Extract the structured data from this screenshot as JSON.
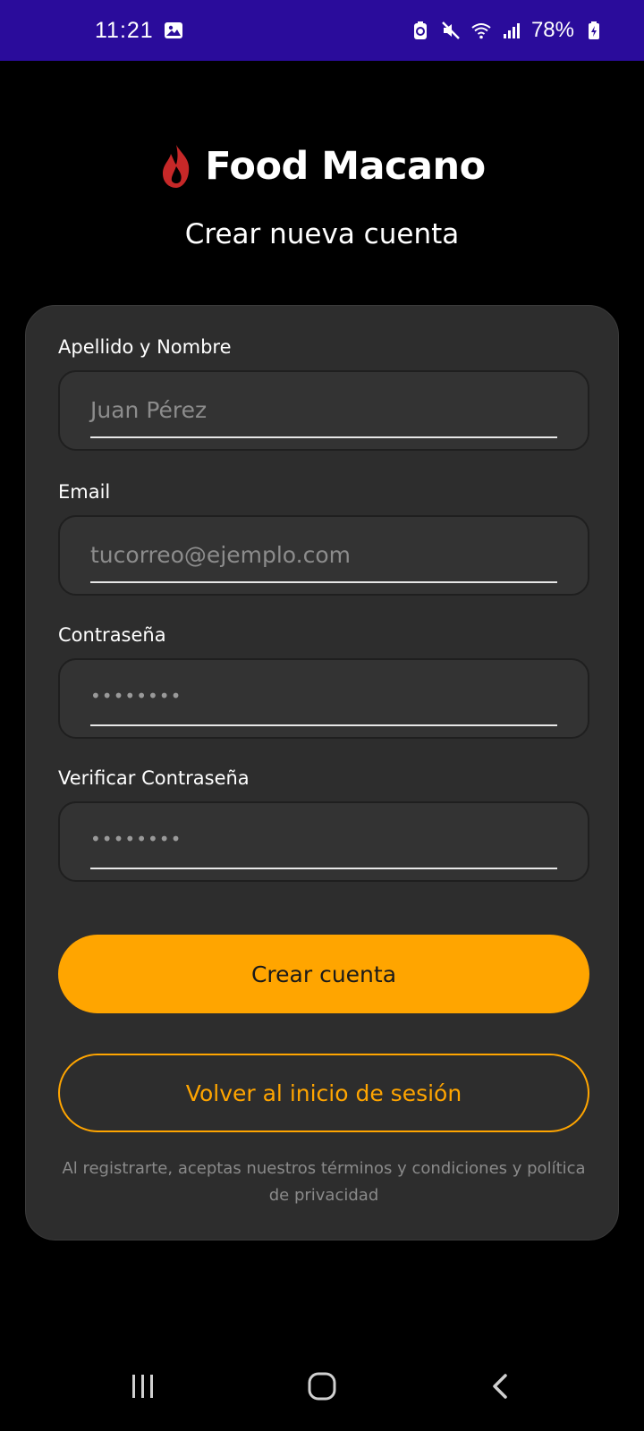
{
  "status_bar": {
    "time": "11:21",
    "battery": "78%",
    "icons": [
      "gallery-icon",
      "battery-saver-icon",
      "mute-icon",
      "wifi-icon",
      "signal-icon",
      "battery-icon"
    ]
  },
  "brand": {
    "name": "Food Macano",
    "logo_icon": "flame-icon",
    "logo_color": "#c62828"
  },
  "page": {
    "title": "Crear nueva cuenta"
  },
  "form": {
    "fields": [
      {
        "label": "Apellido y Nombre",
        "placeholder": "Juan Pérez",
        "type": "text"
      },
      {
        "label": "Email",
        "placeholder": "tucorreo@ejemplo.com",
        "type": "email"
      },
      {
        "label": "Contraseña",
        "placeholder": "••••••••",
        "type": "password"
      },
      {
        "label": "Verificar Contraseña",
        "placeholder": "••••••••",
        "type": "password"
      }
    ],
    "submit_label": "Crear cuenta",
    "back_label": "Volver al inicio de sesión",
    "terms": "Al registrarte, aceptas nuestros términos y condiciones y política de privacidad"
  },
  "colors": {
    "accent": "#ffa500",
    "status_bar_bg": "#2a0c9b",
    "card_bg": "#2d2d2d",
    "background": "#000000"
  },
  "nav_bar": {
    "icons": [
      "recent-apps-icon",
      "home-icon",
      "back-icon"
    ]
  }
}
